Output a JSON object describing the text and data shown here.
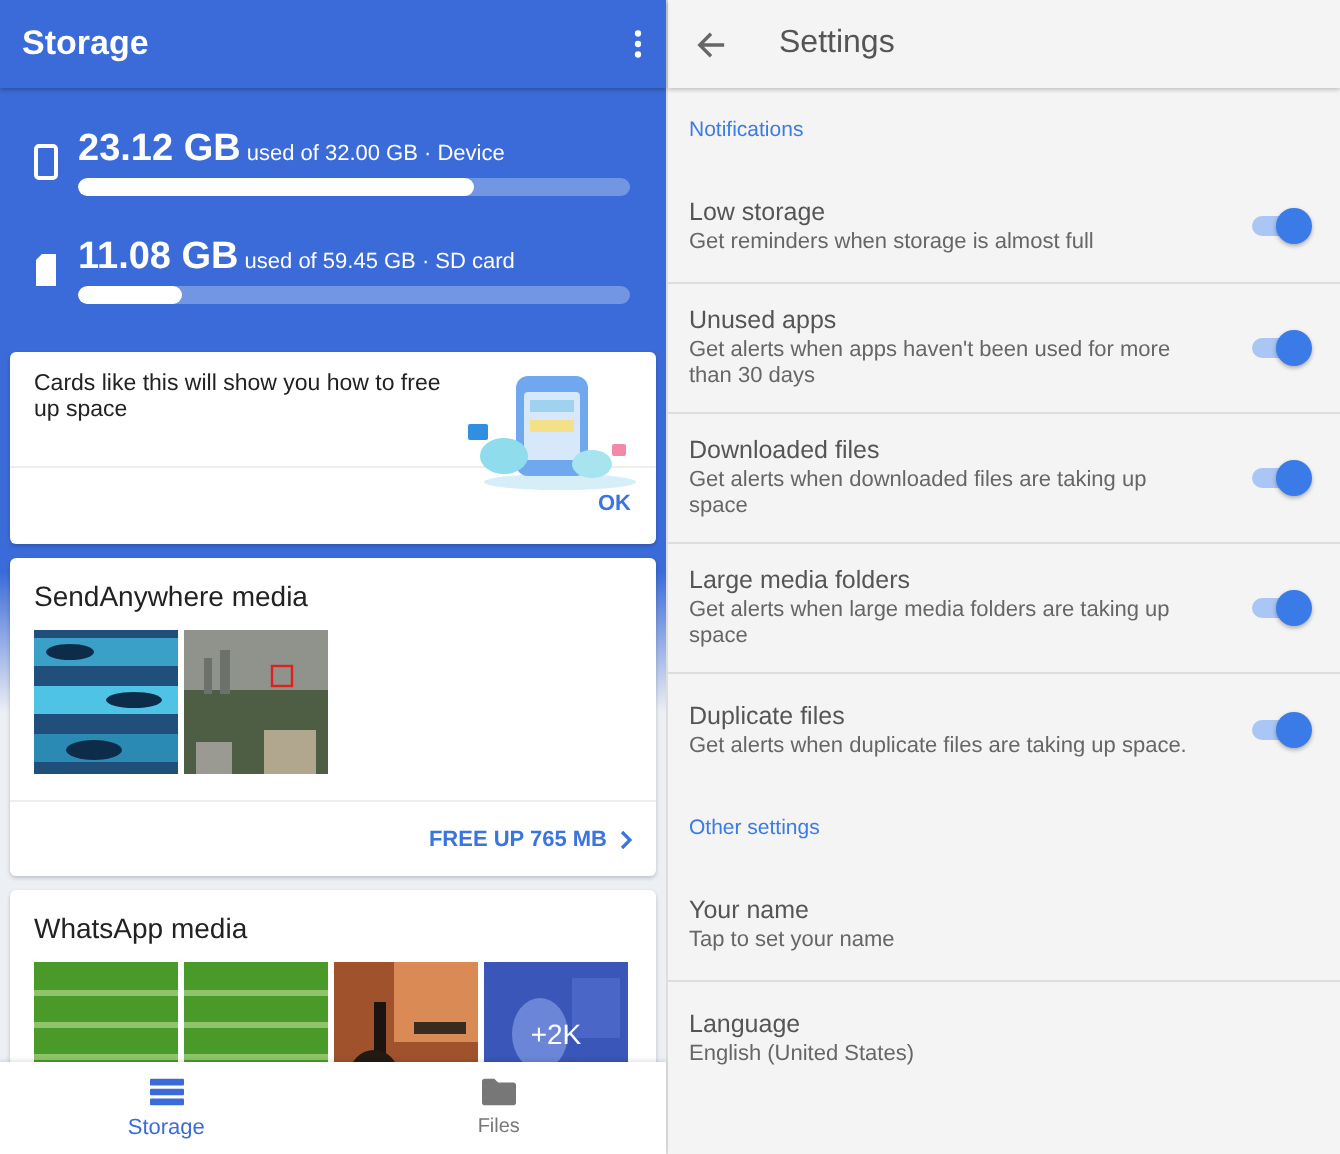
{
  "storage_screen": {
    "title": "Storage",
    "volumes": [
      {
        "kind": "device",
        "amount": "23.12 GB",
        "detail": "used of 32.00 GB · Device",
        "level": 0.72
      },
      {
        "kind": "sdcard",
        "amount": "11.08 GB",
        "detail": "used of 59.45 GB · SD card",
        "level": 0.19
      }
    ],
    "tip_card": {
      "text": "Cards like this will show you how to free up space",
      "action": "OK"
    },
    "media_cards": [
      {
        "title": "SendAnywhere media",
        "thumbnails": [
          {
            "kind": "picture"
          },
          {
            "kind": "picture"
          }
        ],
        "action": "FREE UP 765 MB"
      },
      {
        "title": "WhatsApp media",
        "thumbnails": [
          {
            "kind": "picture"
          },
          {
            "kind": "picture"
          },
          {
            "kind": "picture"
          },
          {
            "kind": "picture",
            "overlay": "+2K"
          }
        ]
      }
    ],
    "bottom_nav": [
      {
        "label": "Storage",
        "selected": true
      },
      {
        "label": "Files",
        "selected": false
      }
    ]
  },
  "settings_screen": {
    "title": "Settings",
    "sections": [
      {
        "header": "Notifications",
        "items": [
          {
            "title": "Low storage",
            "subtitle": "Get reminders when storage is almost full",
            "on": true
          },
          {
            "title": "Unused apps",
            "subtitle": "Get alerts when apps haven't been used for more than 30 days",
            "on": true
          },
          {
            "title": "Downloaded files",
            "subtitle": "Get alerts when downloaded files are taking up space",
            "on": true
          },
          {
            "title": "Large media folders",
            "subtitle": "Get alerts when large media folders are taking up space",
            "on": true
          },
          {
            "title": "Duplicate files",
            "subtitle": "Get alerts when duplicate files are taking up space.",
            "on": true
          }
        ]
      },
      {
        "header": "Other settings",
        "items": [
          {
            "title": "Your name",
            "subtitle": "Tap to set your name"
          },
          {
            "title": "Language",
            "subtitle": "English (United States)"
          }
        ]
      }
    ]
  }
}
